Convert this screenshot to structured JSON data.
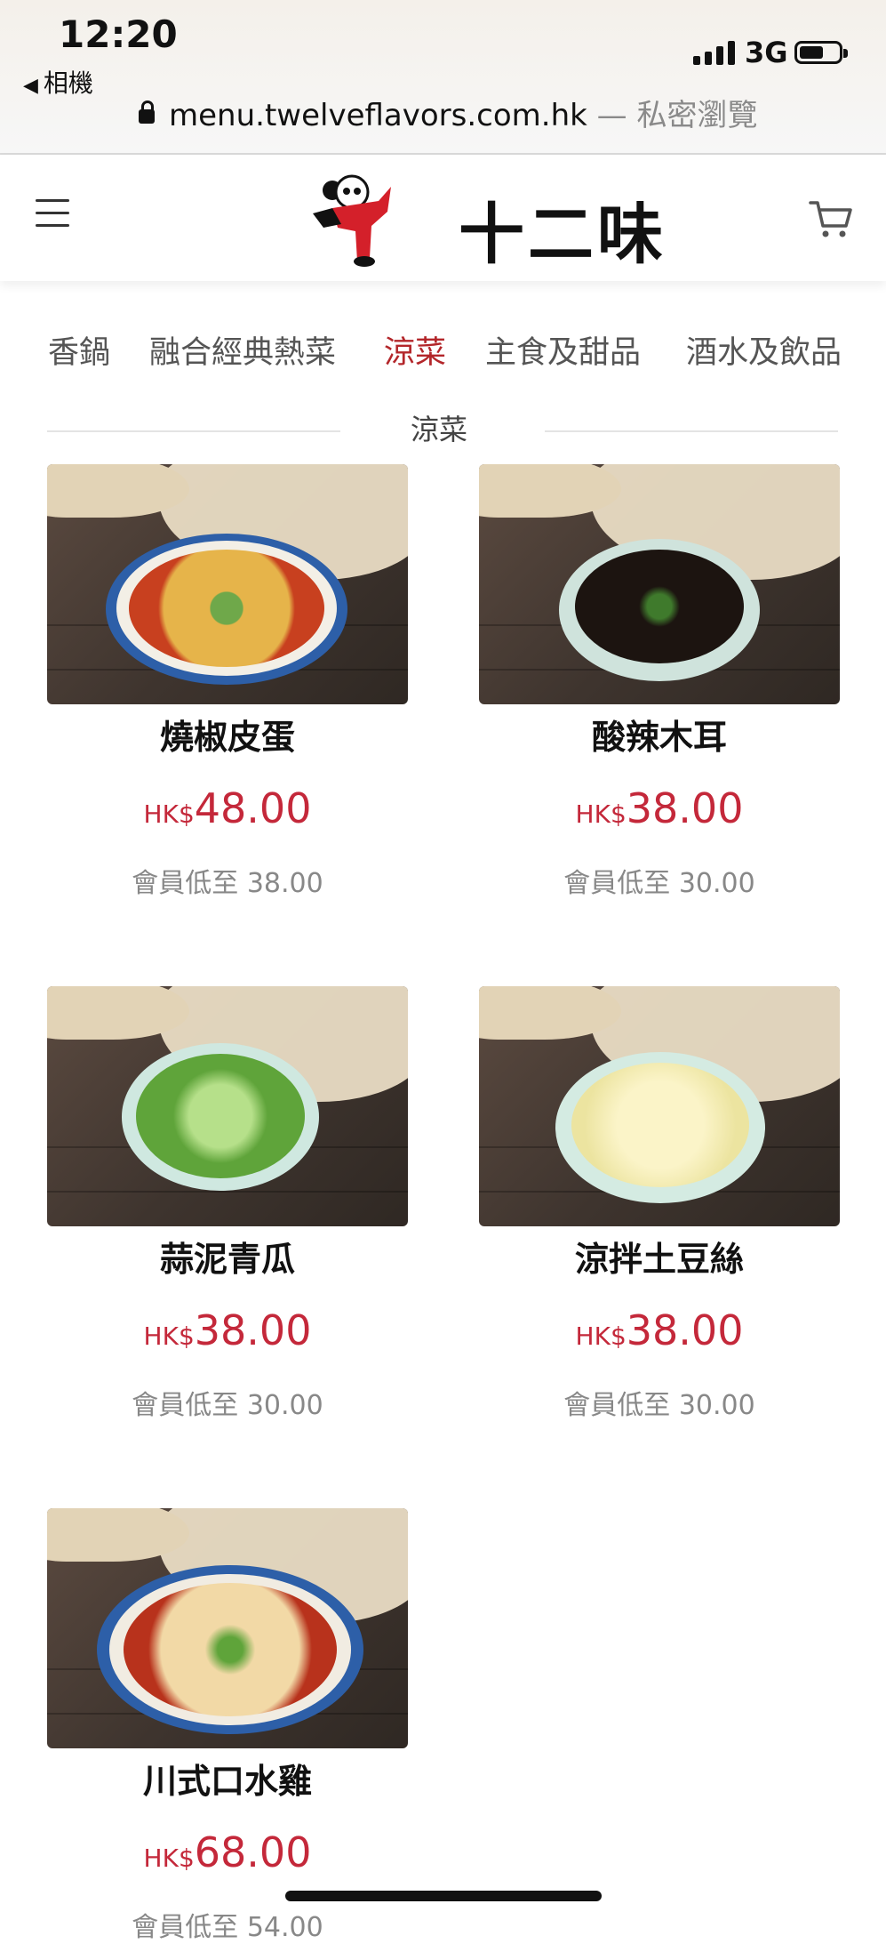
{
  "status": {
    "time": "12:20",
    "back_label": "相機",
    "network": "3G"
  },
  "browser": {
    "url": "menu.twelveflavors.com.hk",
    "mode": "— 私密瀏覽"
  },
  "header": {
    "logo_text": "十二味",
    "menu_icon": "hamburger-icon",
    "cart_icon": "cart-icon"
  },
  "tabs": [
    {
      "label": "香鍋",
      "active": false
    },
    {
      "label": "融合經典熱菜",
      "active": false
    },
    {
      "label": "涼菜",
      "active": true
    },
    {
      "label": "主食及甜品",
      "active": false
    },
    {
      "label": "酒水及飲品",
      "active": false
    }
  ],
  "section_title": "涼菜",
  "products": [
    {
      "name": "燒椒皮蛋",
      "currency": "HK$",
      "price": "48.00",
      "member_price": "會員低至 38.00"
    },
    {
      "name": "酸辣木耳",
      "currency": "HK$",
      "price": "38.00",
      "member_price": "會員低至 30.00"
    },
    {
      "name": "蒜泥青瓜",
      "currency": "HK$",
      "price": "38.00",
      "member_price": "會員低至 30.00"
    },
    {
      "name": "涼拌土豆絲",
      "currency": "HK$",
      "price": "38.00",
      "member_price": "會員低至 30.00"
    },
    {
      "name": "川式口水雞",
      "currency": "HK$",
      "price": "68.00",
      "member_price": "會員低至 54.00"
    }
  ],
  "colors": {
    "accent": "#b3262a",
    "price": "#c4283a",
    "muted": "#888888"
  }
}
